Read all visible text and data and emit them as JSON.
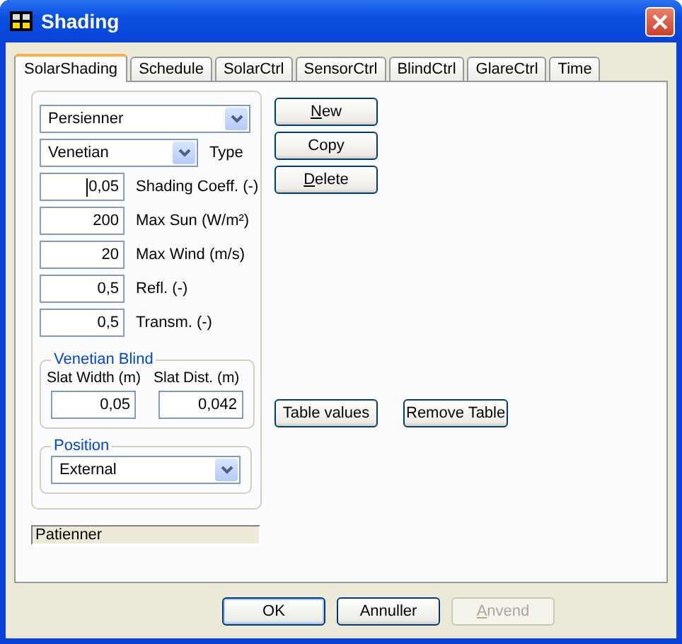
{
  "window": {
    "title": "Shading"
  },
  "tabs": [
    {
      "label": "SolarShading",
      "selected": true
    },
    {
      "label": "Schedule",
      "selected": false
    },
    {
      "label": "SolarCtrl",
      "selected": false
    },
    {
      "label": "SensorCtrl",
      "selected": false
    },
    {
      "label": "BlindCtrl",
      "selected": false
    },
    {
      "label": "GlareCtrl",
      "selected": false
    },
    {
      "label": "Time",
      "selected": false
    }
  ],
  "shading_select": {
    "value": "Persienner"
  },
  "type_select": {
    "value": "Venetian",
    "label": "Type"
  },
  "parameters": [
    {
      "value": "0,05",
      "label": "Shading Coeff. (-)",
      "focused": true
    },
    {
      "value": "200",
      "label": "Max Sun (W/m²)",
      "focused": false
    },
    {
      "value": "20",
      "label": "Max Wind (m/s)",
      "focused": false
    },
    {
      "value": "0,5",
      "label": "Refl. (-)",
      "focused": false
    },
    {
      "value": "0,5",
      "label": "Transm. (-)",
      "focused": false
    }
  ],
  "venetian_blind": {
    "title": "Venetian Blind",
    "fields": [
      {
        "label": "Slat Width (m)",
        "value": "0,05"
      },
      {
        "label": "Slat Dist. (m)",
        "value": "0,042"
      }
    ]
  },
  "position": {
    "title": "Position",
    "value": "External"
  },
  "status": "Patienner",
  "side_buttons": [
    {
      "label": "New",
      "underline_first": true
    },
    {
      "label": "Copy",
      "underline_first": false
    },
    {
      "label": "Delete",
      "underline_first": true
    }
  ],
  "table_buttons": [
    {
      "label": "Table values"
    },
    {
      "label": "Remove Table"
    }
  ],
  "dialog_buttons": [
    {
      "label": "OK",
      "disabled": false,
      "default": true,
      "underline_first": false
    },
    {
      "label": "Annuller",
      "disabled": false,
      "default": false,
      "underline_first": false
    },
    {
      "label": "Anvend",
      "disabled": true,
      "default": false,
      "underline_first": true
    }
  ]
}
